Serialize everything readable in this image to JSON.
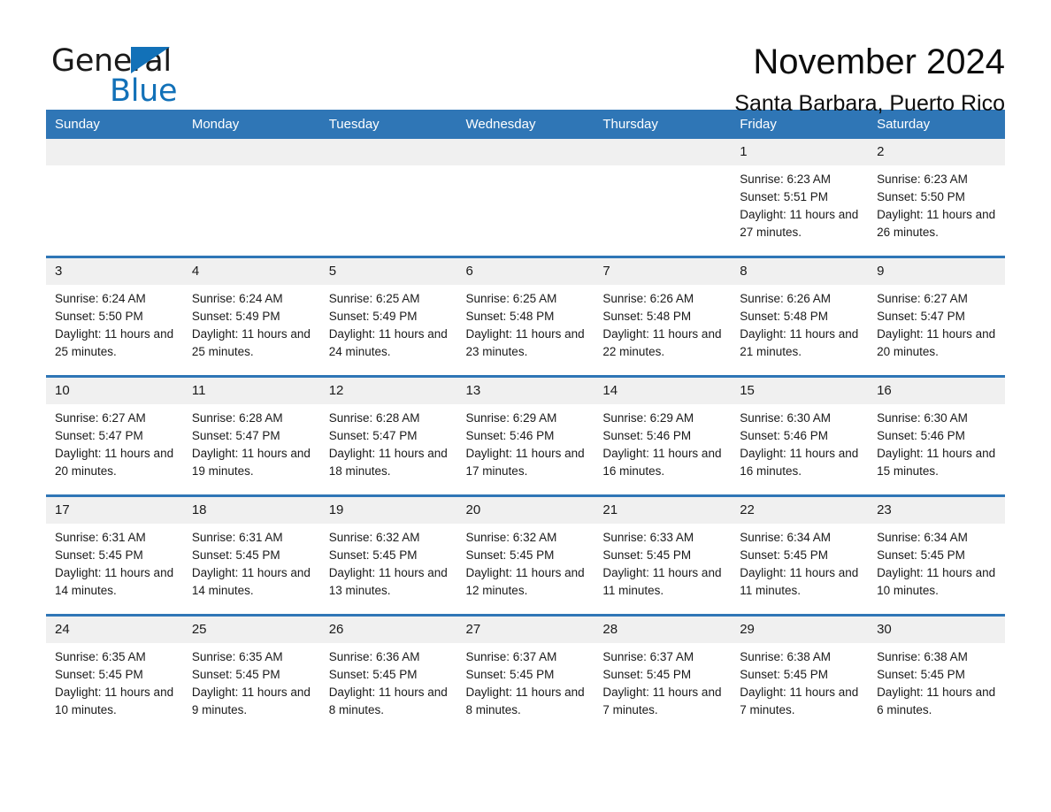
{
  "brand": {
    "name_part1": "General",
    "name_part2": "Blue",
    "triangle_icon": "triangle-icon",
    "accent_color": "#1271b8"
  },
  "header": {
    "month_title": "November 2024",
    "location": "Santa Barbara, Puerto Rico"
  },
  "calendar": {
    "header_color": "#2f76b6",
    "daynum_band_color": "#f0f0f0",
    "weekdays": [
      "Sunday",
      "Monday",
      "Tuesday",
      "Wednesday",
      "Thursday",
      "Friday",
      "Saturday"
    ],
    "labels": {
      "sunrise_prefix": "Sunrise:",
      "sunset_prefix": "Sunset:",
      "daylight_prefix": "Daylight:"
    },
    "weeks": [
      [
        {
          "day": "",
          "blank": true
        },
        {
          "day": "",
          "blank": true
        },
        {
          "day": "",
          "blank": true
        },
        {
          "day": "",
          "blank": true
        },
        {
          "day": "",
          "blank": true
        },
        {
          "day": "1",
          "sunrise": "Sunrise: 6:23 AM",
          "sunset": "Sunset: 5:51 PM",
          "daylight": "Daylight: 11 hours and 27 minutes."
        },
        {
          "day": "2",
          "sunrise": "Sunrise: 6:23 AM",
          "sunset": "Sunset: 5:50 PM",
          "daylight": "Daylight: 11 hours and 26 minutes."
        }
      ],
      [
        {
          "day": "3",
          "sunrise": "Sunrise: 6:24 AM",
          "sunset": "Sunset: 5:50 PM",
          "daylight": "Daylight: 11 hours and 25 minutes."
        },
        {
          "day": "4",
          "sunrise": "Sunrise: 6:24 AM",
          "sunset": "Sunset: 5:49 PM",
          "daylight": "Daylight: 11 hours and 25 minutes."
        },
        {
          "day": "5",
          "sunrise": "Sunrise: 6:25 AM",
          "sunset": "Sunset: 5:49 PM",
          "daylight": "Daylight: 11 hours and 24 minutes."
        },
        {
          "day": "6",
          "sunrise": "Sunrise: 6:25 AM",
          "sunset": "Sunset: 5:48 PM",
          "daylight": "Daylight: 11 hours and 23 minutes."
        },
        {
          "day": "7",
          "sunrise": "Sunrise: 6:26 AM",
          "sunset": "Sunset: 5:48 PM",
          "daylight": "Daylight: 11 hours and 22 minutes."
        },
        {
          "day": "8",
          "sunrise": "Sunrise: 6:26 AM",
          "sunset": "Sunset: 5:48 PM",
          "daylight": "Daylight: 11 hours and 21 minutes."
        },
        {
          "day": "9",
          "sunrise": "Sunrise: 6:27 AM",
          "sunset": "Sunset: 5:47 PM",
          "daylight": "Daylight: 11 hours and 20 minutes."
        }
      ],
      [
        {
          "day": "10",
          "sunrise": "Sunrise: 6:27 AM",
          "sunset": "Sunset: 5:47 PM",
          "daylight": "Daylight: 11 hours and 20 minutes."
        },
        {
          "day": "11",
          "sunrise": "Sunrise: 6:28 AM",
          "sunset": "Sunset: 5:47 PM",
          "daylight": "Daylight: 11 hours and 19 minutes."
        },
        {
          "day": "12",
          "sunrise": "Sunrise: 6:28 AM",
          "sunset": "Sunset: 5:47 PM",
          "daylight": "Daylight: 11 hours and 18 minutes."
        },
        {
          "day": "13",
          "sunrise": "Sunrise: 6:29 AM",
          "sunset": "Sunset: 5:46 PM",
          "daylight": "Daylight: 11 hours and 17 minutes."
        },
        {
          "day": "14",
          "sunrise": "Sunrise: 6:29 AM",
          "sunset": "Sunset: 5:46 PM",
          "daylight": "Daylight: 11 hours and 16 minutes."
        },
        {
          "day": "15",
          "sunrise": "Sunrise: 6:30 AM",
          "sunset": "Sunset: 5:46 PM",
          "daylight": "Daylight: 11 hours and 16 minutes."
        },
        {
          "day": "16",
          "sunrise": "Sunrise: 6:30 AM",
          "sunset": "Sunset: 5:46 PM",
          "daylight": "Daylight: 11 hours and 15 minutes."
        }
      ],
      [
        {
          "day": "17",
          "sunrise": "Sunrise: 6:31 AM",
          "sunset": "Sunset: 5:45 PM",
          "daylight": "Daylight: 11 hours and 14 minutes."
        },
        {
          "day": "18",
          "sunrise": "Sunrise: 6:31 AM",
          "sunset": "Sunset: 5:45 PM",
          "daylight": "Daylight: 11 hours and 14 minutes."
        },
        {
          "day": "19",
          "sunrise": "Sunrise: 6:32 AM",
          "sunset": "Sunset: 5:45 PM",
          "daylight": "Daylight: 11 hours and 13 minutes."
        },
        {
          "day": "20",
          "sunrise": "Sunrise: 6:32 AM",
          "sunset": "Sunset: 5:45 PM",
          "daylight": "Daylight: 11 hours and 12 minutes."
        },
        {
          "day": "21",
          "sunrise": "Sunrise: 6:33 AM",
          "sunset": "Sunset: 5:45 PM",
          "daylight": "Daylight: 11 hours and 11 minutes."
        },
        {
          "day": "22",
          "sunrise": "Sunrise: 6:34 AM",
          "sunset": "Sunset: 5:45 PM",
          "daylight": "Daylight: 11 hours and 11 minutes."
        },
        {
          "day": "23",
          "sunrise": "Sunrise: 6:34 AM",
          "sunset": "Sunset: 5:45 PM",
          "daylight": "Daylight: 11 hours and 10 minutes."
        }
      ],
      [
        {
          "day": "24",
          "sunrise": "Sunrise: 6:35 AM",
          "sunset": "Sunset: 5:45 PM",
          "daylight": "Daylight: 11 hours and 10 minutes."
        },
        {
          "day": "25",
          "sunrise": "Sunrise: 6:35 AM",
          "sunset": "Sunset: 5:45 PM",
          "daylight": "Daylight: 11 hours and 9 minutes."
        },
        {
          "day": "26",
          "sunrise": "Sunrise: 6:36 AM",
          "sunset": "Sunset: 5:45 PM",
          "daylight": "Daylight: 11 hours and 8 minutes."
        },
        {
          "day": "27",
          "sunrise": "Sunrise: 6:37 AM",
          "sunset": "Sunset: 5:45 PM",
          "daylight": "Daylight: 11 hours and 8 minutes."
        },
        {
          "day": "28",
          "sunrise": "Sunrise: 6:37 AM",
          "sunset": "Sunset: 5:45 PM",
          "daylight": "Daylight: 11 hours and 7 minutes."
        },
        {
          "day": "29",
          "sunrise": "Sunrise: 6:38 AM",
          "sunset": "Sunset: 5:45 PM",
          "daylight": "Daylight: 11 hours and 7 minutes."
        },
        {
          "day": "30",
          "sunrise": "Sunrise: 6:38 AM",
          "sunset": "Sunset: 5:45 PM",
          "daylight": "Daylight: 11 hours and 6 minutes."
        }
      ]
    ]
  }
}
